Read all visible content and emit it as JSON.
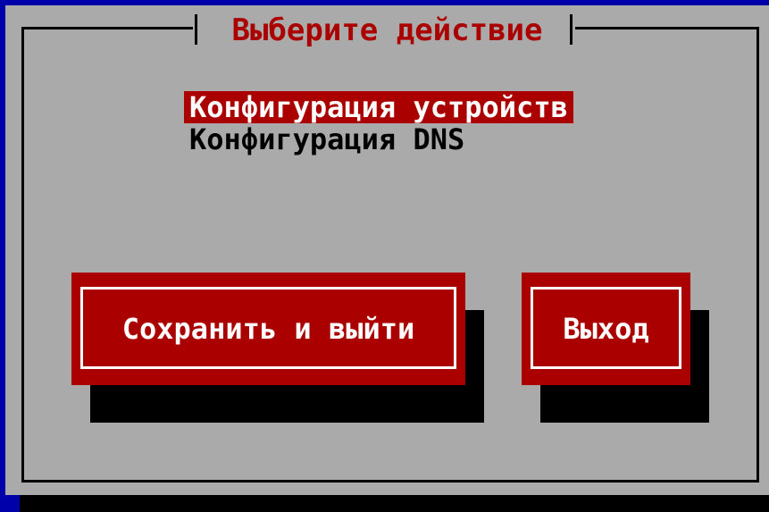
{
  "dialog": {
    "title": "Выберите действие"
  },
  "menu": {
    "items": [
      {
        "label": "Конфигурация устройств",
        "selected": true
      },
      {
        "label": "Конфигурация DNS",
        "selected": false
      }
    ]
  },
  "buttons": {
    "save_exit_label": "Сохранить и выйти",
    "exit_label": "Выход"
  },
  "colors": {
    "background": "#0000aa",
    "dialog": "#aaaaaa",
    "accent": "#aa0000",
    "text_on_accent": "#ffffff",
    "text": "#000000"
  }
}
